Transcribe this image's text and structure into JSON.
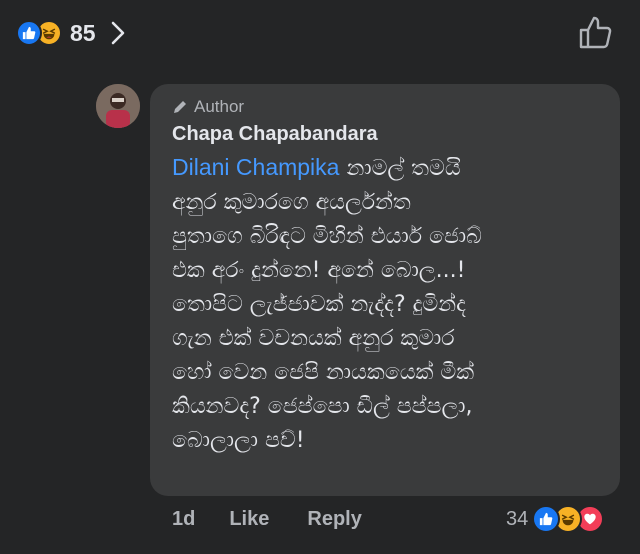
{
  "top": {
    "reaction_count": "85"
  },
  "comment": {
    "badge": "Author",
    "name": "Chapa Chapabandara",
    "mention": "Dilani Champika",
    "text": " නාමල් තමයි\nඅනුර කුමාරගෙ අයර්ලන්ත\nපුතාගෙ බිරිඳට මිහින් එයාර් ජොබ්\nඑක අරං දුන්නෙ! අනේ බොල...!\nතොපිට ලැජ්ජාවක් නැද්ද? දුමින්ද\nගැන එක් වචනයක් අනුර කුමාර\nහෝ වෙන ජෙපි නායකයෙක් මීක්\nකියනවද? ජෙප්පො ඩීල් පප්පලා,\nබොලාලා පව්!"
  },
  "actions": {
    "time": "1d",
    "like": "Like",
    "reply": "Reply",
    "reaction_count": "34"
  },
  "icons": [
    "like-reaction-icon",
    "haha-reaction-icon",
    "love-reaction-icon",
    "chevron-right-icon",
    "thumbs-up-icon",
    "pencil-icon"
  ],
  "colors": {
    "background": "#242526",
    "bubble": "#3a3b3c",
    "mention": "#4599ff",
    "like": "#1877f2",
    "haha": "#f7b125",
    "love": "#f33e58"
  }
}
